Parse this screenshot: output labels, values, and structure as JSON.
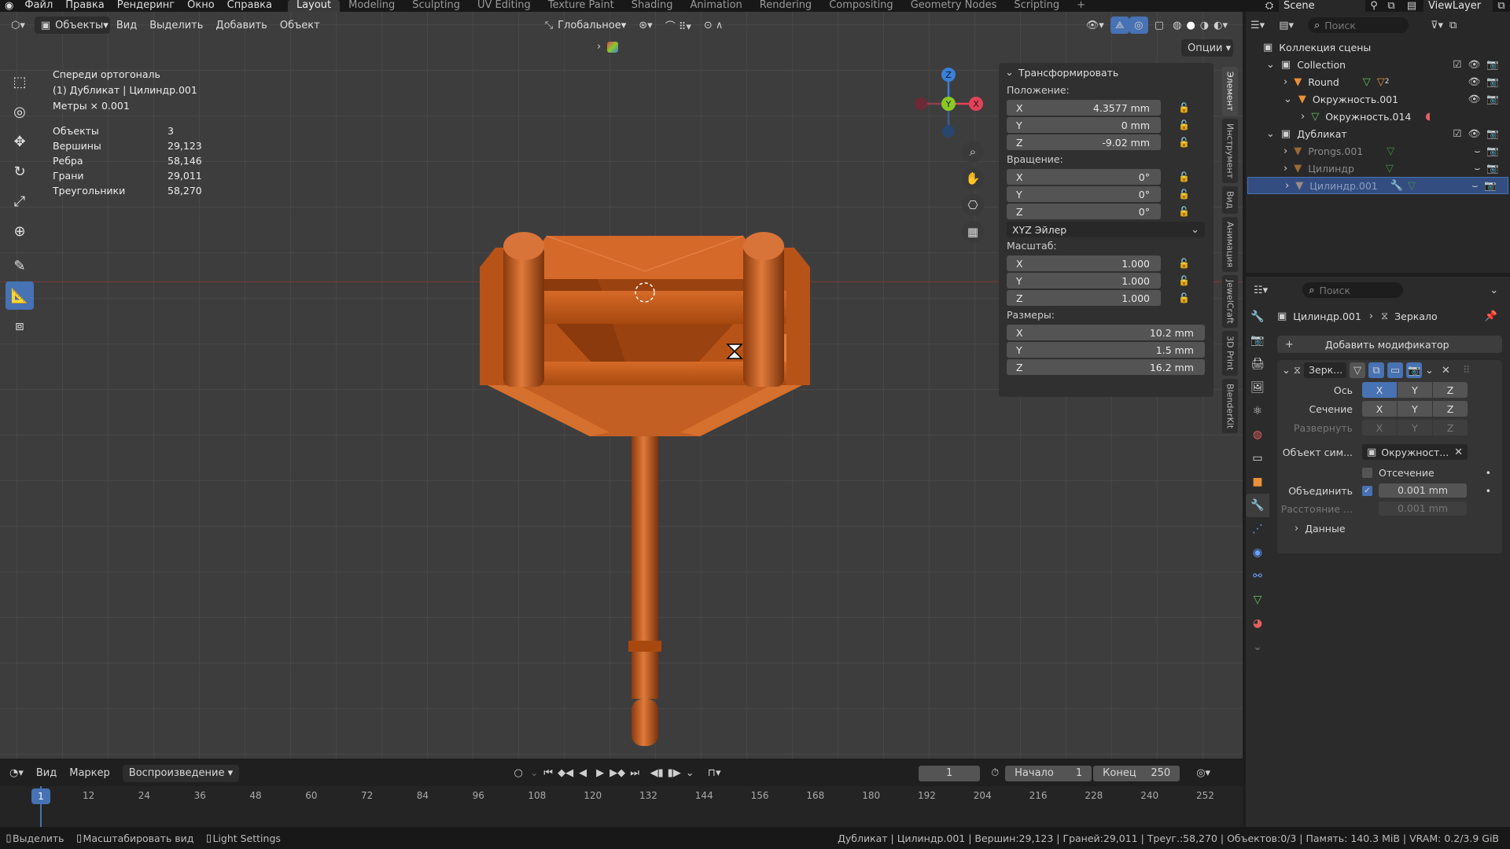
{
  "menu": {
    "items": [
      "Файл",
      "Правка",
      "Рендеринг",
      "Окно",
      "Справка"
    ],
    "workspaces": [
      "Layout",
      "Modeling",
      "Sculpting",
      "UV Editing",
      "Texture Paint",
      "Shading",
      "Animation",
      "Rendering",
      "Compositing",
      "Geometry Nodes",
      "Scripting"
    ],
    "active_workspace": "Layout",
    "scene": "Scene",
    "view_layer": "ViewLayer"
  },
  "viewport_header": {
    "mode": "Объекты",
    "menus": [
      "Вид",
      "Выделить",
      "Добавить",
      "Объект"
    ],
    "orientation": "Глобальное",
    "options": "Опции"
  },
  "viewport_info": {
    "view_name": "Спереди ортогональ",
    "object_line": "(1) Дубликат | Цилиндр.001",
    "units": "Метры × 0.001",
    "stats": [
      {
        "label": "Объекты",
        "value": "3"
      },
      {
        "label": "Вершины",
        "value": "29,123"
      },
      {
        "label": "Ребра",
        "value": "58,146"
      },
      {
        "label": "Грани",
        "value": "29,011"
      },
      {
        "label": "Треугольники",
        "value": "58,270"
      }
    ]
  },
  "n_panel": {
    "title": "Трансформировать",
    "location_label": "Положение:",
    "location": [
      {
        "axis": "X",
        "value": "4.3577 mm"
      },
      {
        "axis": "Y",
        "value": "0 mm"
      },
      {
        "axis": "Z",
        "value": "-9.02 mm"
      }
    ],
    "rotation_label": "Вращение:",
    "rotation": [
      {
        "axis": "X",
        "value": "0°"
      },
      {
        "axis": "Y",
        "value": "0°"
      },
      {
        "axis": "Z",
        "value": "0°"
      }
    ],
    "rotation_mode": "XYZ Эйлер",
    "scale_label": "Масштаб:",
    "scale": [
      {
        "axis": "X",
        "value": "1.000"
      },
      {
        "axis": "Y",
        "value": "1.000"
      },
      {
        "axis": "Z",
        "value": "1.000"
      }
    ],
    "dimensions_label": "Размеры:",
    "dimensions": [
      {
        "axis": "X",
        "value": "10.2 mm"
      },
      {
        "axis": "Y",
        "value": "1.5 mm"
      },
      {
        "axis": "Z",
        "value": "16.2 mm"
      }
    ],
    "tabs": [
      "Элемент",
      "Инструмент",
      "Вид",
      "Анимация",
      "JewelCraft",
      "3D Print",
      "BlenderKit"
    ]
  },
  "gizmo": {
    "x": "X",
    "y": "Y",
    "z": "Z"
  },
  "outliner": {
    "search_placeholder": "Поиск",
    "root": "Коллекция сцены",
    "rows": [
      {
        "label": "Collection",
        "indent": 1
      },
      {
        "label": "Round",
        "indent": 2,
        "badge": "2"
      },
      {
        "label": "Окружность.001",
        "indent": 2
      },
      {
        "label": "Окружность.014",
        "indent": 3
      },
      {
        "label": "Дубликат",
        "indent": 1
      },
      {
        "label": "Prongs.001",
        "indent": 2
      },
      {
        "label": "Цилиндр",
        "indent": 2
      },
      {
        "label": "Цилиндр.001",
        "indent": 2
      }
    ]
  },
  "properties": {
    "search_placeholder": "Поиск",
    "breadcrumb_object": "Цилиндр.001",
    "breadcrumb_modifier": "Зеркало",
    "add_modifier": "Добавить модификатор",
    "modifier_name": "Зерк...",
    "axis_label": "Ось",
    "bisect_label": "Сечение",
    "flip_label": "Развернуть",
    "axes": [
      "X",
      "Y",
      "Z"
    ],
    "mirror_object_label": "Объект сим...",
    "mirror_object_value": "Окружност...",
    "clipping_label": "Отсечение",
    "merge_label": "Объединить",
    "merge_value": "0.001 mm",
    "distance_label": "Расстояние ...",
    "distance_value": "0.001 mm",
    "data_label": "Данные"
  },
  "timeline": {
    "menus": [
      "Вид",
      "Маркер"
    ],
    "playback": "Воспроизведение",
    "current_frame": "1",
    "start_label": "Начало",
    "start": "1",
    "end_label": "Конец",
    "end": "250",
    "ticks": [
      "1",
      "12",
      "24",
      "36",
      "48",
      "60",
      "72",
      "84",
      "96",
      "108",
      "120",
      "132",
      "144",
      "156",
      "168",
      "180",
      "192",
      "204",
      "216",
      "228",
      "240",
      "252"
    ]
  },
  "statusbar": {
    "left": [
      "Выделить",
      "Масштабировать вид",
      "Light Settings"
    ],
    "right": "Дубликат | Цилиндр.001 | Вершин:29,123 | Граней:29,011 | Треуг.:58,270 | Объектов:0/3 | Память: 140.3 MiB | VRAM: 0.2/3.9 GiB"
  },
  "colors": {
    "accent": "#4772b3",
    "object": "#c8581a",
    "x_axis": "#e04358",
    "y_axis": "#8ac926",
    "z_axis": "#3b7fd6"
  }
}
